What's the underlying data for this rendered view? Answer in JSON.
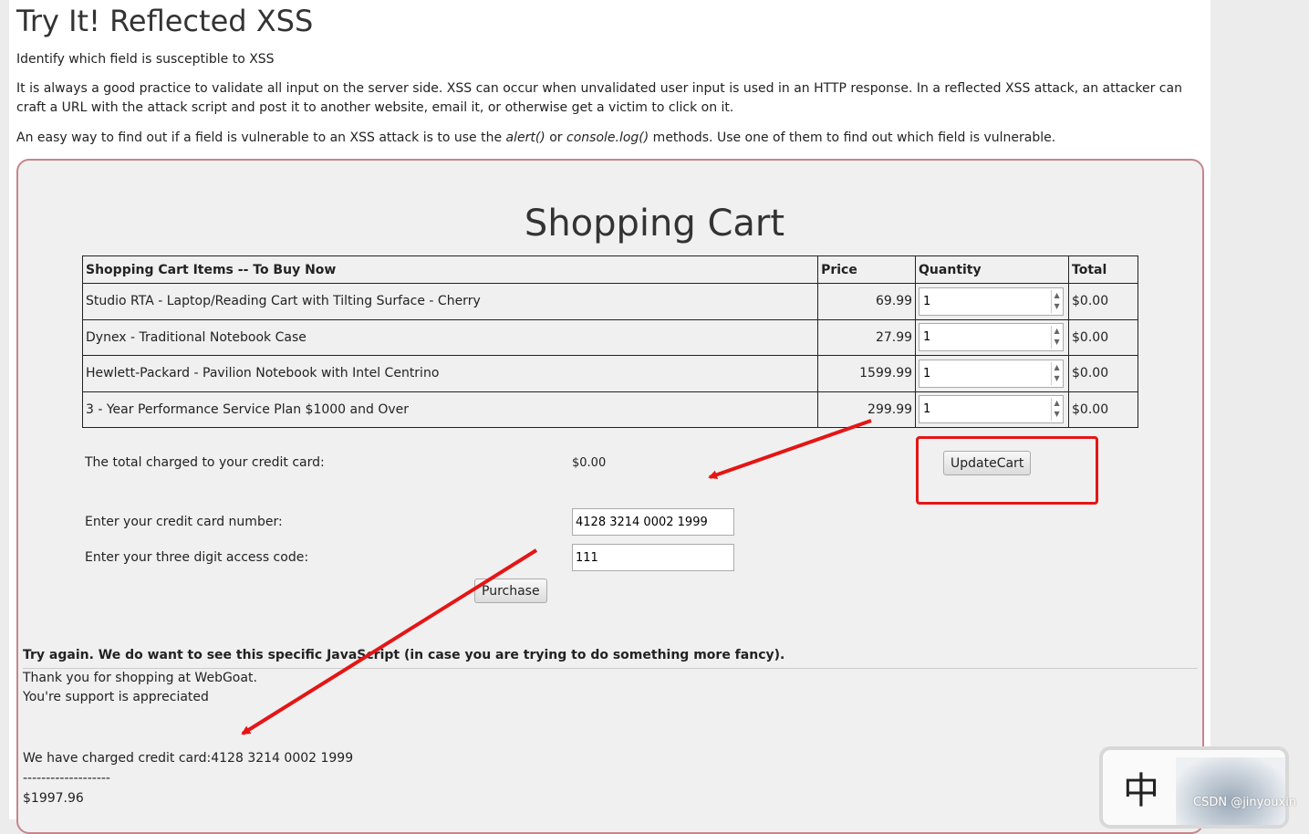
{
  "page": {
    "title": "Try It! Reflected XSS",
    "intro": "Identify which field is susceptible to XSS",
    "para2": "It is always a good practice to validate all input on the server side. XSS can occur when unvalidated user input is used in an HTTP response. In a reflected XSS attack, an attacker can craft a URL with the attack script and post it to another website, email it, or otherwise get a victim to click on it.",
    "para3_a": "An easy way to find out if a field is vulnerable to an XSS attack is to use the ",
    "para3_alert": "alert()",
    "para3_or": " or ",
    "para3_console": "console.log()",
    "para3_b": " methods. Use one of them to find out which field is vulnerable."
  },
  "cart": {
    "title": "Shopping Cart",
    "headers": {
      "item": "Shopping Cart Items -- To Buy Now",
      "price": "Price",
      "quantity": "Quantity",
      "total": "Total"
    },
    "rows": [
      {
        "item": "Studio RTA - Laptop/Reading Cart with Tilting Surface - Cherry",
        "price": "69.99",
        "qty": "1",
        "total": "$0.00"
      },
      {
        "item": "Dynex - Traditional Notebook Case",
        "price": "27.99",
        "qty": "1",
        "total": "$0.00"
      },
      {
        "item": "Hewlett-Packard - Pavilion Notebook with Intel Centrino",
        "price": "1599.99",
        "qty": "1",
        "total": "$0.00"
      },
      {
        "item": "3 - Year Performance Service Plan $1000 and Over",
        "price": "299.99",
        "qty": "1",
        "total": "$0.00"
      }
    ],
    "total_label": "The total charged to your credit card:",
    "total_value": "$0.00",
    "update_button": "UpdateCart",
    "cc_label": "Enter your credit card number:",
    "cc_value": "4128 3214 0002 1999",
    "code_label": "Enter your three digit access code:",
    "code_value": "111",
    "purchase_button": "Purchase"
  },
  "feedback": {
    "message": "Try again. We do want to see this specific JavaScript (in case you are trying to do something more fancy).",
    "line1": "Thank you for shopping at WebGoat.",
    "line2": "You're support is appreciated",
    "charged": "We have charged credit card:4128 3214 0002 1999",
    "separator": "-------------------",
    "amount": "$1997.96"
  },
  "watermark": {
    "glyph": "中",
    "text": "CSDN @jinyouxin"
  },
  "colors": {
    "annotation_red": "#e51515",
    "panel_border": "#c4868d",
    "panel_bg": "#f0f0f0"
  }
}
